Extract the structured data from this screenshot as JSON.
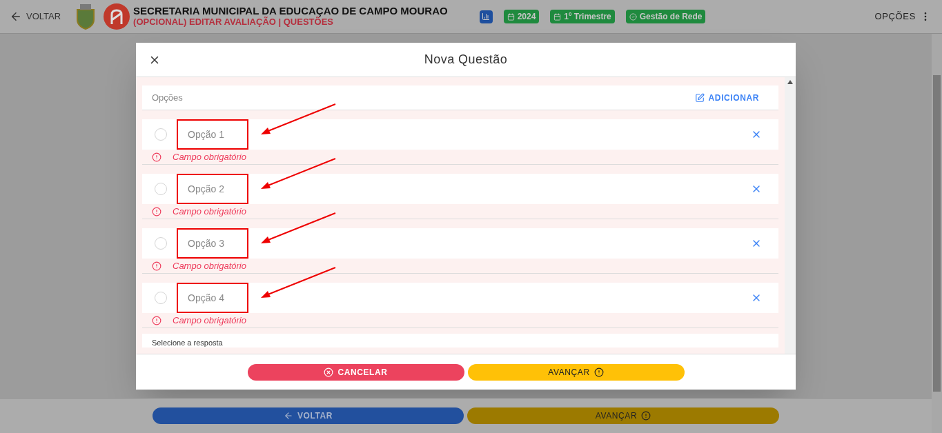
{
  "header": {
    "back": "VOLTAR",
    "title": "SECRETARIA MUNICIPAL DA EDUCAÇAO DE CAMPO MOURAO",
    "subtitle": "(OPCIONAL) EDITAR AVALIAÇÃO | QUESTÕES",
    "badges": [
      {
        "kind": "chart"
      },
      {
        "kind": "calendar",
        "label": "2024"
      },
      {
        "kind": "calendar",
        "label": "1º Trimestre"
      },
      {
        "kind": "check",
        "label": "Gestão de Rede"
      }
    ],
    "menu": "OPÇÕES"
  },
  "modal": {
    "title": "Nova Questão",
    "section_label": "Opções",
    "add_button": "ADICIONAR",
    "options": [
      {
        "placeholder": "Opção 1",
        "selected": false,
        "error": "Campo obrigatório",
        "highlighted": true
      },
      {
        "placeholder": "Opção 2",
        "selected": false,
        "error": "Campo obrigatório",
        "highlighted": true
      },
      {
        "placeholder": "Opção 3",
        "selected": false,
        "error": "Campo obrigatório",
        "highlighted": true
      },
      {
        "placeholder": "Opção 4",
        "selected": false,
        "error": "Campo obrigatório",
        "highlighted": true
      }
    ],
    "next_section": "Selecione a resposta",
    "cancel": "CANCELAR",
    "advance": "AVANÇAR"
  },
  "footer": {
    "back": "VOLTAR",
    "advance": "AVANÇAR"
  }
}
